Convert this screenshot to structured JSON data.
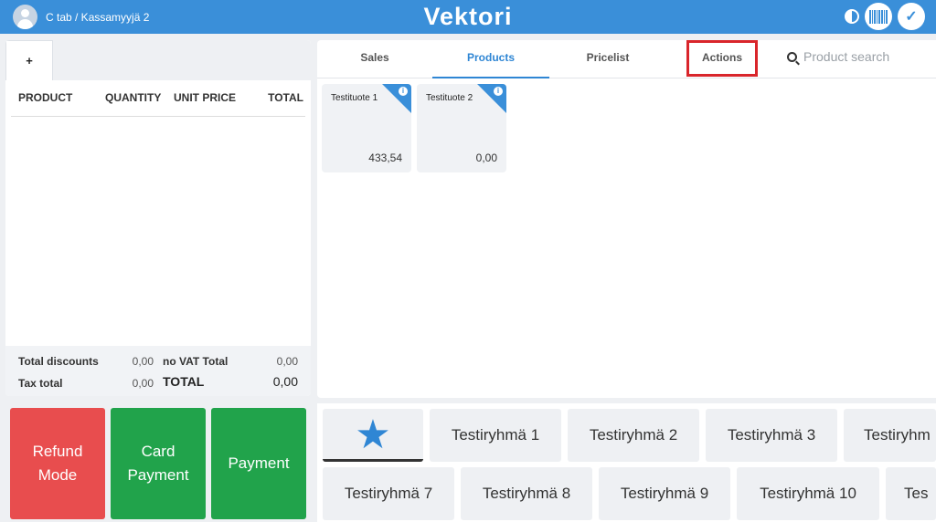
{
  "header": {
    "user_label": "C tab / Kassamyyjä 2",
    "brand": "Vektori",
    "accent_color": "#3a8fd9",
    "icons": [
      "user-avatar-icon",
      "contrast-icon",
      "barcode-icon",
      "check-icon"
    ]
  },
  "cart": {
    "add_tab_label": "+",
    "columns": [
      "PRODUCT",
      "QUANTITY",
      "UNIT PRICE",
      "TOTAL"
    ],
    "totals": {
      "total_discounts_label": "Total discounts",
      "total_discounts_value": "0,00",
      "no_vat_total_label": "no VAT Total",
      "no_vat_total_value": "0,00",
      "tax_total_label": "Tax total",
      "tax_total_value": "0,00",
      "total_label": "TOTAL",
      "total_value": "0,00"
    }
  },
  "actions": {
    "refund_mode_label": "Refund Mode",
    "card_payment_label": "Card Payment",
    "payment_label": "Payment",
    "refund_color": "#e84d4e",
    "payment_color": "#21a34b"
  },
  "tabs": {
    "items": [
      {
        "label": "Sales"
      },
      {
        "label": "Products"
      },
      {
        "label": "Pricelist"
      },
      {
        "label": "Actions"
      }
    ],
    "active": "Products",
    "highlighted": "Actions",
    "highlight_color": "#d9252b"
  },
  "search": {
    "placeholder": "Product search"
  },
  "products": [
    {
      "name": "Testituote 1",
      "price": "433,54"
    },
    {
      "name": "Testituote 2",
      "price": "0,00"
    }
  ],
  "groups": {
    "row1": [
      "Testiryhmä 1",
      "Testiryhmä 2",
      "Testiryhmä 3",
      "Testiryhm"
    ],
    "row2": [
      "Testiryhmä 7",
      "Testiryhmä 8",
      "Testiryhmä 9",
      "Testiryhmä 10",
      "Tes"
    ],
    "favorites_icon": "star-icon"
  }
}
